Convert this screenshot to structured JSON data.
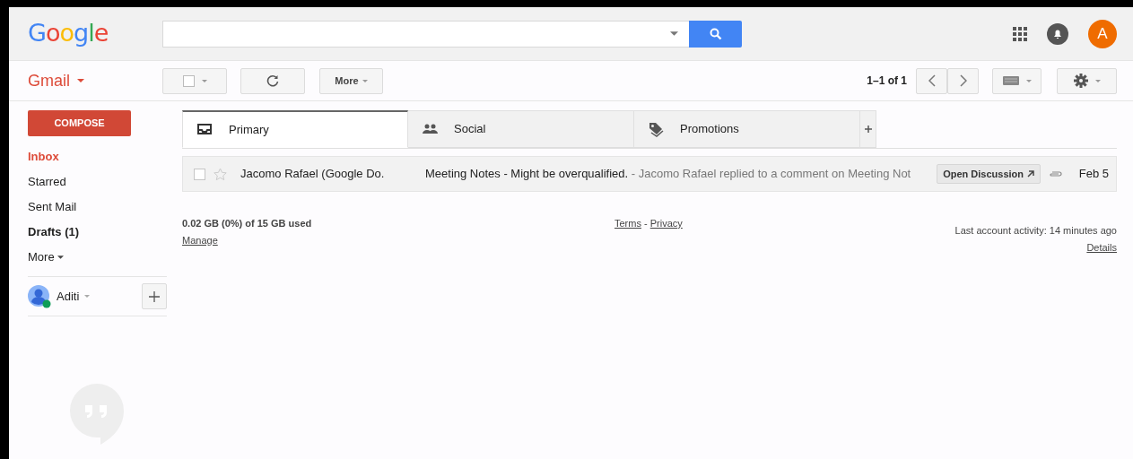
{
  "header": {
    "logo": "Google",
    "avatar": "A"
  },
  "toolbar": {
    "app": "Gmail",
    "more": "More",
    "pagination": "1–1 of 1"
  },
  "sidebar": {
    "compose": "COMPOSE",
    "items": [
      {
        "label": "Inbox",
        "selected": true,
        "bold": true
      },
      {
        "label": "Starred",
        "selected": false,
        "bold": false
      },
      {
        "label": "Sent Mail",
        "selected": false,
        "bold": false
      },
      {
        "label": "Drafts (1)",
        "selected": false,
        "bold": true
      },
      {
        "label": "More",
        "selected": false,
        "bold": false
      }
    ],
    "account": "Aditi",
    "online": true
  },
  "tabs": [
    {
      "label": "Primary",
      "kind": "inbox",
      "selected": true
    },
    {
      "label": "Social",
      "kind": "people",
      "selected": false
    },
    {
      "label": "Promotions",
      "kind": "tag",
      "selected": false
    }
  ],
  "emails": [
    {
      "sender": "Jacomo Rafael (Google Do.",
      "subject": "Meeting Notes - Might be overqualified.",
      "snippet": " - Jacomo Rafael replied to a comment on Meeting Not",
      "action": "Open Discussion",
      "attachment": true,
      "date": "Feb 5",
      "checked": false,
      "starred": false
    }
  ],
  "footer": {
    "storage": "0.02 GB (0%) of 15 GB used",
    "manage": "Manage",
    "terms": "Terms",
    "separator": "-",
    "privacy": "Privacy",
    "activity": "Last account activity: 14 minutes ago",
    "details": "Details"
  }
}
